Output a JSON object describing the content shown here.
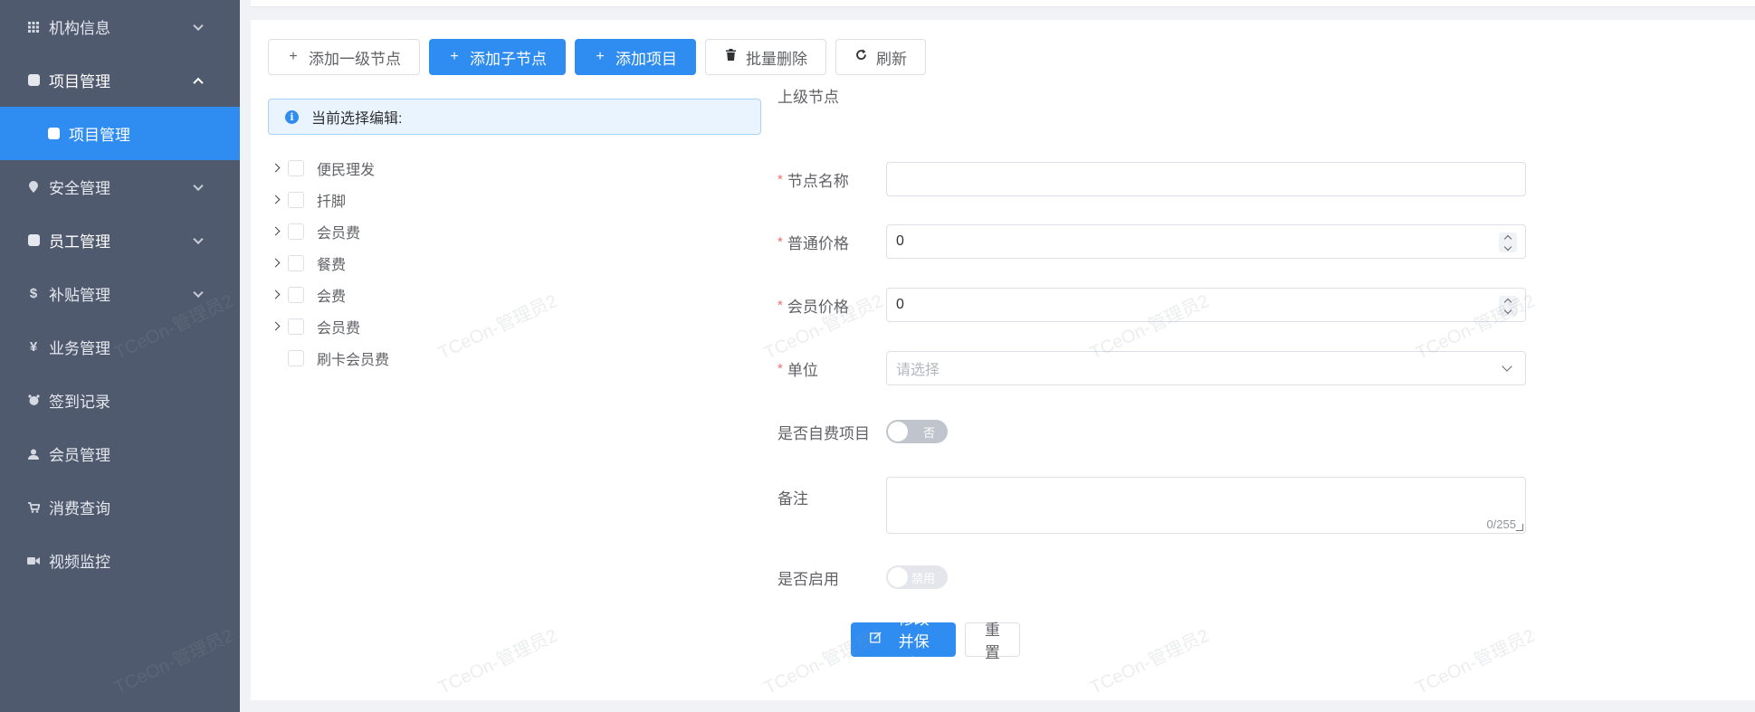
{
  "sidebar": {
    "items": [
      {
        "label": "机构信息",
        "icon": "grid-icon"
      },
      {
        "label": "项目管理",
        "icon": "doc-icon"
      },
      {
        "label": "项目管理",
        "icon": "doc-icon"
      },
      {
        "label": "安全管理",
        "icon": "pin-icon"
      },
      {
        "label": "员工管理",
        "icon": "doc-icon"
      },
      {
        "label": "补贴管理",
        "icon": "dollar-icon"
      },
      {
        "label": "业务管理",
        "icon": "yen-icon"
      },
      {
        "label": "签到记录",
        "icon": "alarm-icon"
      },
      {
        "label": "会员管理",
        "icon": "user-icon"
      },
      {
        "label": "消费查询",
        "icon": "cart-icon"
      },
      {
        "label": "视频监控",
        "icon": "camera-icon"
      }
    ]
  },
  "toolbar": {
    "add_root": "添加一级节点",
    "add_child": "添加子节点",
    "add_item": "添加项目",
    "batch_delete": "批量删除",
    "refresh": "刷新"
  },
  "alert": {
    "text": "当前选择编辑:"
  },
  "tree": {
    "nodes": [
      {
        "label": "便民理发",
        "expandable": true
      },
      {
        "label": "扦脚",
        "expandable": true
      },
      {
        "label": "会员费",
        "expandable": true
      },
      {
        "label": "餐费",
        "expandable": true
      },
      {
        "label": "会费",
        "expandable": true
      },
      {
        "label": "会员费",
        "expandable": true
      },
      {
        "label": "刷卡会员费",
        "expandable": false
      }
    ]
  },
  "form": {
    "parent_label": "上级节点",
    "name_label": "节点名称",
    "name_value": "",
    "normal_price_label": "普通价格",
    "normal_price_value": "0",
    "member_price_label": "会员价格",
    "member_price_value": "0",
    "unit_label": "单位",
    "unit_placeholder": "请选择",
    "self_pay_label": "是否自费项目",
    "self_pay_text": "否",
    "remark_label": "备注",
    "remark_count": "0/255",
    "enabled_label": "是否启用",
    "enabled_text": "禁用",
    "save_button": "修改并保存",
    "reset_button": "重置",
    "required_mark": "*"
  },
  "watermark": "TCeOn-管理员2",
  "colors": {
    "sidebar_bg": "#505a6e",
    "primary": "#2f8cf0",
    "required": "#f56c6c"
  }
}
